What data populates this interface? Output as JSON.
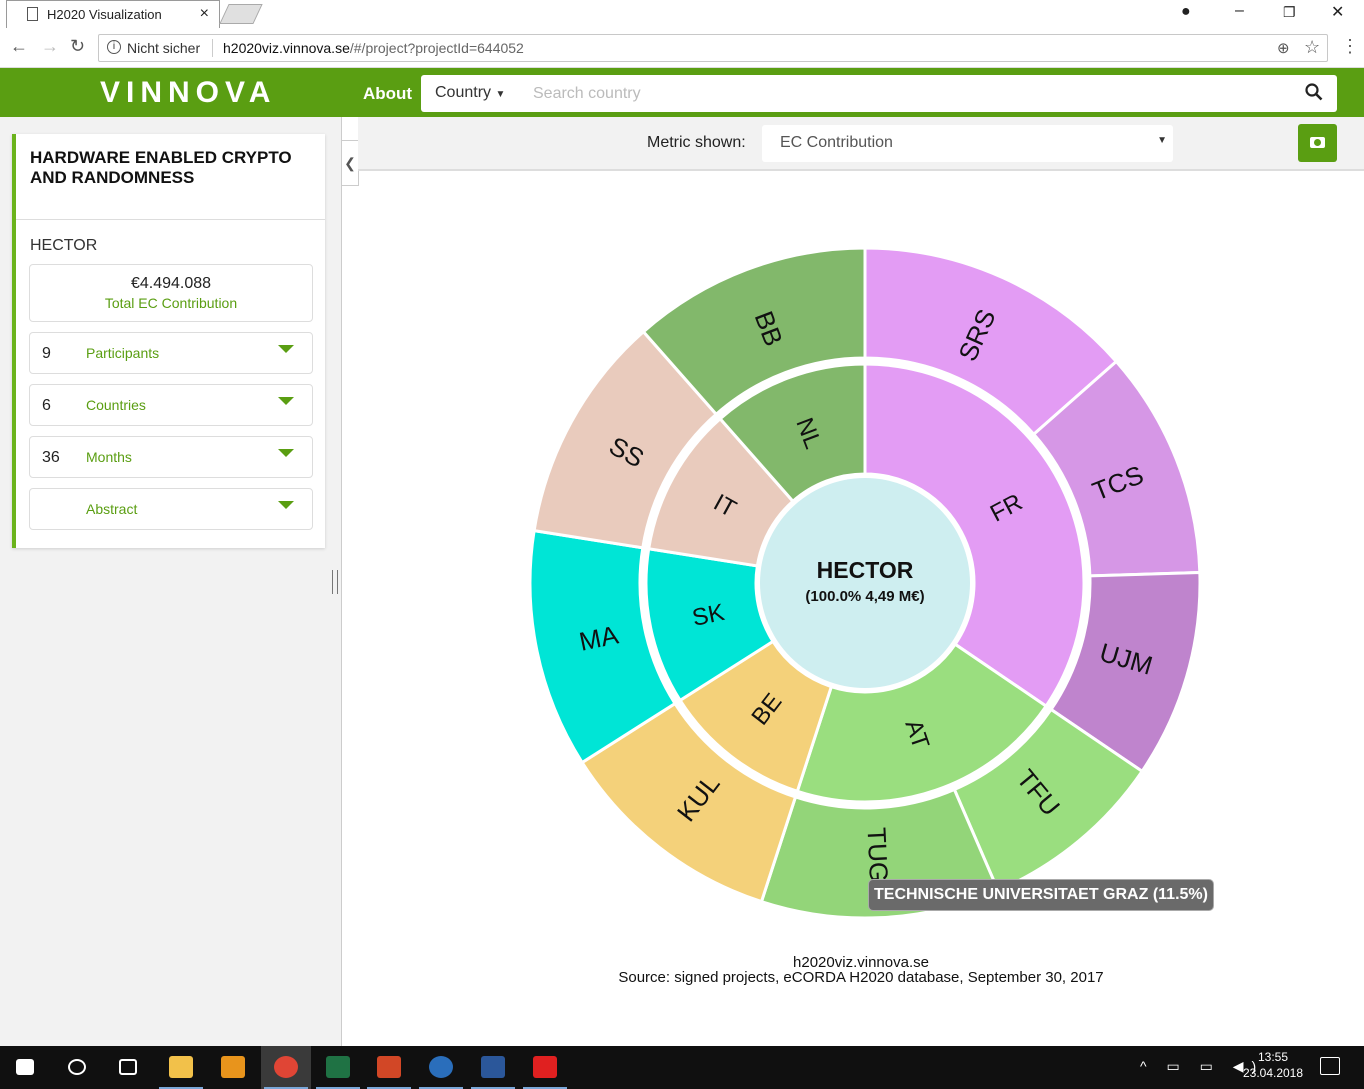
{
  "browser": {
    "tab_title": "H2020 Visualization",
    "tab_close": "×",
    "security_label": "Nicht sicher",
    "url_host": "h2020viz.vinnova.se",
    "url_path": "/#/project?projectId=644052"
  },
  "header": {
    "logo": "VINNOVA",
    "about_label": "About",
    "country_label": "Country",
    "search_placeholder": "Search country"
  },
  "project": {
    "title": "HARDWARE ENABLED CRYPTO AND RANDOMNESS",
    "acronym": "HECTOR",
    "total_value": "€4.494.088",
    "total_label": "Total EC Contribution",
    "stats": [
      {
        "count": "9",
        "label": "Participants"
      },
      {
        "count": "6",
        "label": "Countries"
      },
      {
        "count": "36",
        "label": "Months"
      },
      {
        "count": "",
        "label": "Abstract"
      }
    ]
  },
  "metric": {
    "label": "Metric shown:",
    "value": "EC Contribution"
  },
  "chart_data": {
    "type": "sunburst",
    "center": {
      "label": "HECTOR",
      "sub": "(100.0% 4,49 M€)"
    },
    "countries": [
      {
        "code": "FR",
        "share": 34.5,
        "color": "#e39cf4"
      },
      {
        "code": "AT",
        "share": 20.5,
        "color": "#9ade7f"
      },
      {
        "code": "BE",
        "share": 11.0,
        "color": "#f4d17a"
      },
      {
        "code": "SK",
        "share": 11.5,
        "color": "#00e5d6"
      },
      {
        "code": "IT",
        "share": 11.0,
        "color": "#e9cbbd"
      },
      {
        "code": "NL",
        "share": 11.5,
        "color": "#82b86b"
      }
    ],
    "participants": [
      {
        "code": "SRS",
        "country": "FR",
        "share": 13.5,
        "color": "#e39cf4"
      },
      {
        "code": "TCS",
        "country": "FR",
        "share": 11.0,
        "color": "#d697e6"
      },
      {
        "code": "UJM",
        "country": "FR",
        "share": 10.0,
        "color": "#bf84cd"
      },
      {
        "code": "TFU",
        "country": "AT",
        "share": 9.0,
        "color": "#9ade7f"
      },
      {
        "code": "TUG",
        "country": "AT",
        "share": 11.5,
        "color": "#93d579"
      },
      {
        "code": "KUL",
        "country": "BE",
        "share": 11.0,
        "color": "#f4d17a"
      },
      {
        "code": "MA",
        "country": "SK",
        "share": 11.5,
        "color": "#00e5d6"
      },
      {
        "code": "SS",
        "country": "IT",
        "share": 11.0,
        "color": "#e9cbbd"
      },
      {
        "code": "BB",
        "country": "NL",
        "share": 11.5,
        "color": "#82b86b"
      }
    ],
    "center_color": "#ceeef0"
  },
  "tooltip": "TECHNISCHE UNIVERSITAET GRAZ (11.5%)",
  "source": {
    "site": "h2020viz.vinnova.se",
    "text": "Source: signed projects, eCORDA H2020 database, September 30, 2017"
  },
  "taskbar": {
    "time": "13:55",
    "date": "23.04.2018",
    "apps": [
      {
        "name": "start-icon",
        "color": "#ffffff"
      },
      {
        "name": "search-icon",
        "color": "#ffffff"
      },
      {
        "name": "task-view-icon",
        "color": "#ffffff"
      },
      {
        "name": "file-explorer-icon",
        "color": "#f2c14a"
      },
      {
        "name": "outlook-icon",
        "color": "#e8941c"
      },
      {
        "name": "chrome-icon",
        "color": "#e04535"
      },
      {
        "name": "excel-icon",
        "color": "#1f7244"
      },
      {
        "name": "powerpoint-icon",
        "color": "#d24726"
      },
      {
        "name": "r-icon",
        "color": "#2a6ebb"
      },
      {
        "name": "word-icon",
        "color": "#2b579a"
      },
      {
        "name": "acrobat-icon",
        "color": "#e02020"
      }
    ]
  }
}
